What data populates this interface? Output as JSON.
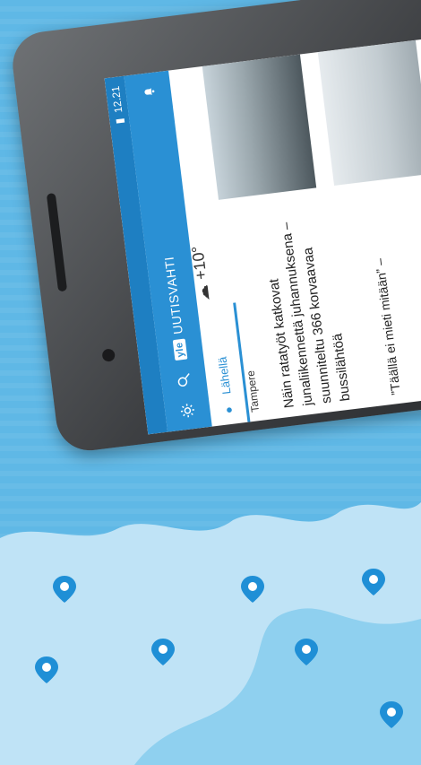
{
  "status": {
    "time": "12.21"
  },
  "appbar": {
    "brand_mark": "yle",
    "title": "UUTISVAHTI"
  },
  "tabs": {
    "active": "Lähellä"
  },
  "weather": {
    "temp": "+10°"
  },
  "card": {
    "city": "Tampere",
    "headline": "Näin ratatyöt katkovat junaliikennettä juhannuksena – suunniteltu 366 korvaavaa bussilähtöä",
    "headline2": "”Täällä ei mieti mitään” –"
  },
  "colors": {
    "accent": "#2a90d4",
    "background": "#5fb8e6"
  }
}
